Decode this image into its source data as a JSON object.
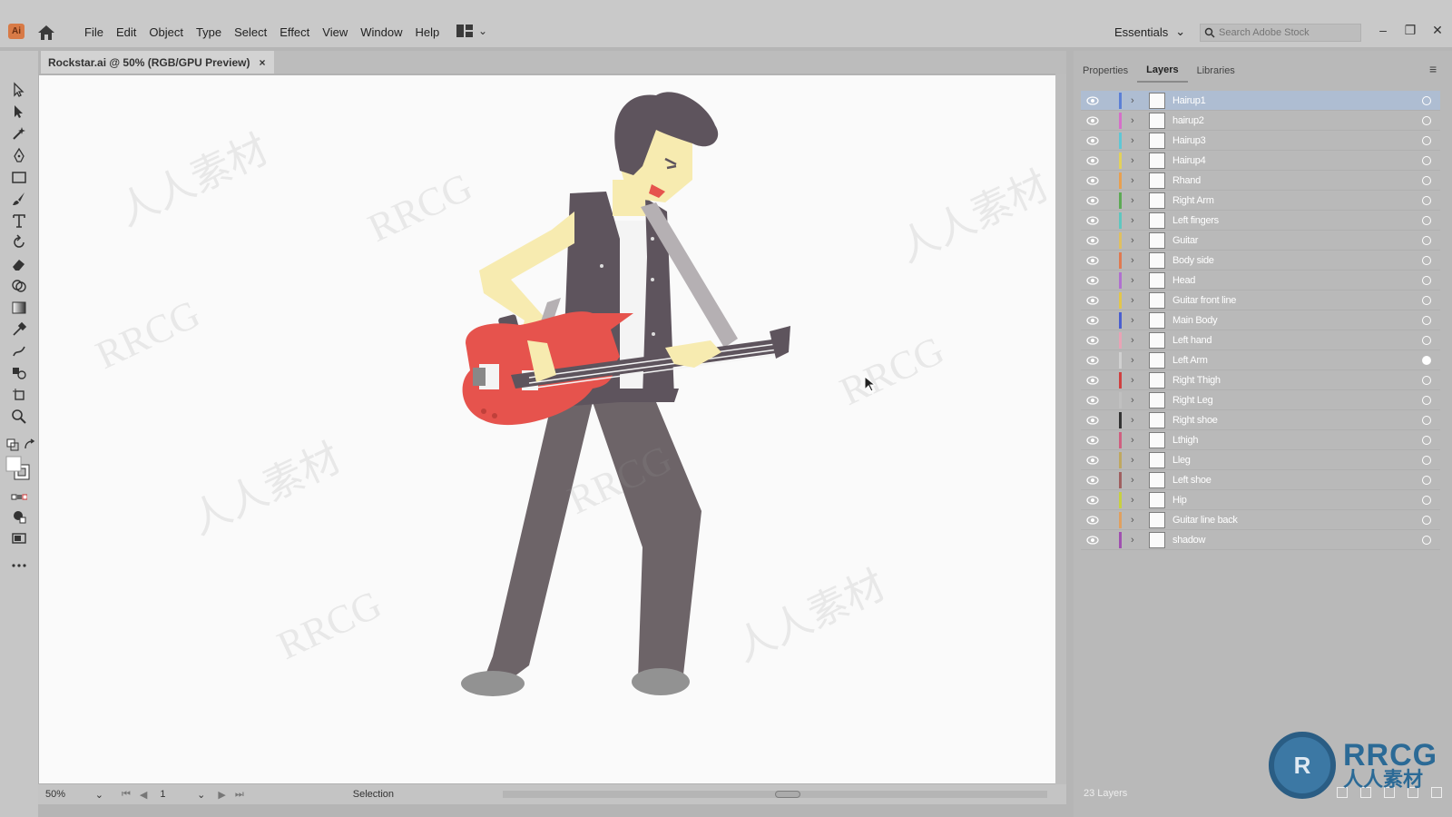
{
  "app": {
    "logo_text": "Ai",
    "menu": [
      "File",
      "Edit",
      "Object",
      "Type",
      "Select",
      "Effect",
      "View",
      "Window",
      "Help"
    ],
    "workspace": "Essentials",
    "search_placeholder": "Search Adobe Stock",
    "window_controls": [
      "minimize-icon",
      "restore-icon",
      "close-icon"
    ]
  },
  "document": {
    "tab_title": "Rockstar.ai @ 50% (RGB/GPU Preview)",
    "tab_close": "×"
  },
  "statusbar": {
    "zoom": "50%",
    "page": "1",
    "tool": "Selection"
  },
  "panel": {
    "tabs": [
      "Properties",
      "Layers",
      "Libraries"
    ],
    "active_tab": "Layers",
    "layer_count": "23 Layers",
    "layers": [
      {
        "name": "Hairup1",
        "color": "#5b7fd6",
        "selected": true
      },
      {
        "name": "hairup2",
        "color": "#d66fc9"
      },
      {
        "name": "Hairup3",
        "color": "#5fc7d6"
      },
      {
        "name": "Hairup4",
        "color": "#e3d15a"
      },
      {
        "name": "Rhand",
        "color": "#e8a050"
      },
      {
        "name": "Right Arm",
        "color": "#5daa55"
      },
      {
        "name": "Left fingers",
        "color": "#5fc7c0"
      },
      {
        "name": "Guitar",
        "color": "#e0c060"
      },
      {
        "name": "Body side",
        "color": "#e07a50"
      },
      {
        "name": "Head",
        "color": "#b070d0"
      },
      {
        "name": "Guitar front line",
        "color": "#e3c64a"
      },
      {
        "name": "Main Body",
        "color": "#4a5fd0"
      },
      {
        "name": "Left hand",
        "color": "#e9a3b5"
      },
      {
        "name": "Left Arm",
        "color": "#d0d0d0",
        "target_filled": true
      },
      {
        "name": "Right Thigh",
        "color": "#d04040"
      },
      {
        "name": "Right Leg",
        "color": "#c0c0c0"
      },
      {
        "name": "Right shoe",
        "color": "#333333"
      },
      {
        "name": "Lthigh",
        "color": "#d06080"
      },
      {
        "name": "Lleg",
        "color": "#c0a860"
      },
      {
        "name": "Left shoe",
        "color": "#a06060"
      },
      {
        "name": "Hip",
        "color": "#c8d040"
      },
      {
        "name": "Guitar line back",
        "color": "#e0a060"
      },
      {
        "name": "shadow",
        "color": "#a050b0"
      }
    ]
  },
  "watermark": {
    "text": "RRCG",
    "cn_text": "人人素材",
    "logo_en": "RRCG",
    "logo_cn": "人人素材"
  },
  "colors": {
    "hair": "#5e545d",
    "skin": "#f7ebb0",
    "vest": "#5e545d",
    "pants": "#6d6468",
    "guitar_body": "#e6534d",
    "strap": "#b5b0b3",
    "shoe": "#929292"
  }
}
